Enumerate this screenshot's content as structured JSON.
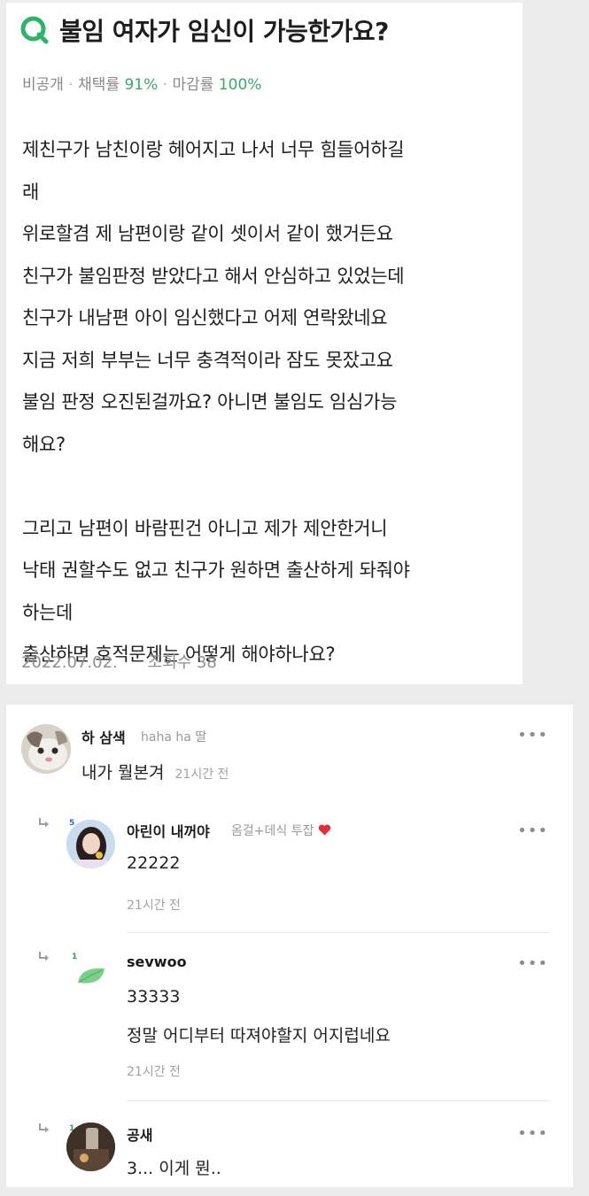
{
  "post": {
    "title": "불임 여자가 임신이 가능한가요?",
    "meta": {
      "visibility": "비공개",
      "adopt_label": "채택률",
      "adopt_rate": "91%",
      "close_label": "마감률",
      "close_rate": "100%"
    },
    "body_lines": [
      "제친구가 남친이랑 헤어지고 나서 너무 힘들어하길",
      "래",
      "위로할겸 제 남편이랑 같이 셋이서 같이 했거든요",
      "친구가 불임판정 받았다고 해서 안심하고 있었는데",
      "친구가 내남편 아이 임신했다고 어제 연락왔네요",
      "지금 저희 부부는 너무 충격적이라 잠도 못잤고요",
      "불임 판정 오진된걸까요? 아니면 불임도 임심가능",
      "해요?",
      "",
      "그리고 남편이 바람핀건 아니고 제가 제안한거니",
      "낙태 권할수도 없고 친구가 원하면 출산하게 돠줘야",
      "하는데",
      "출산하면 호적문제는 어떻게 해야하나요?"
    ],
    "date": "2022.07.02.",
    "views": "조회수 38"
  },
  "comments": [
    {
      "nick": "하 삼색",
      "tag": "haha ha 딸",
      "text": "내가 뭘본겨",
      "time": "21시간 전"
    },
    {
      "nick": "아린이 내꺼야",
      "tag": "옴걸+데식 투잡",
      "level": "5",
      "text": "22222",
      "time": "21시간 전"
    },
    {
      "nick": "sevwoo",
      "level": "1",
      "lines": [
        "33333",
        "정말 어디부터 따져야할지 어지럽네요"
      ],
      "time": "21시간 전"
    },
    {
      "nick": "공새",
      "level": "1",
      "text": "3... 이게 뭔.."
    }
  ],
  "more_label": "•••",
  "colors": {
    "accent_green": "#3da86a",
    "heart": "#e0303a"
  }
}
